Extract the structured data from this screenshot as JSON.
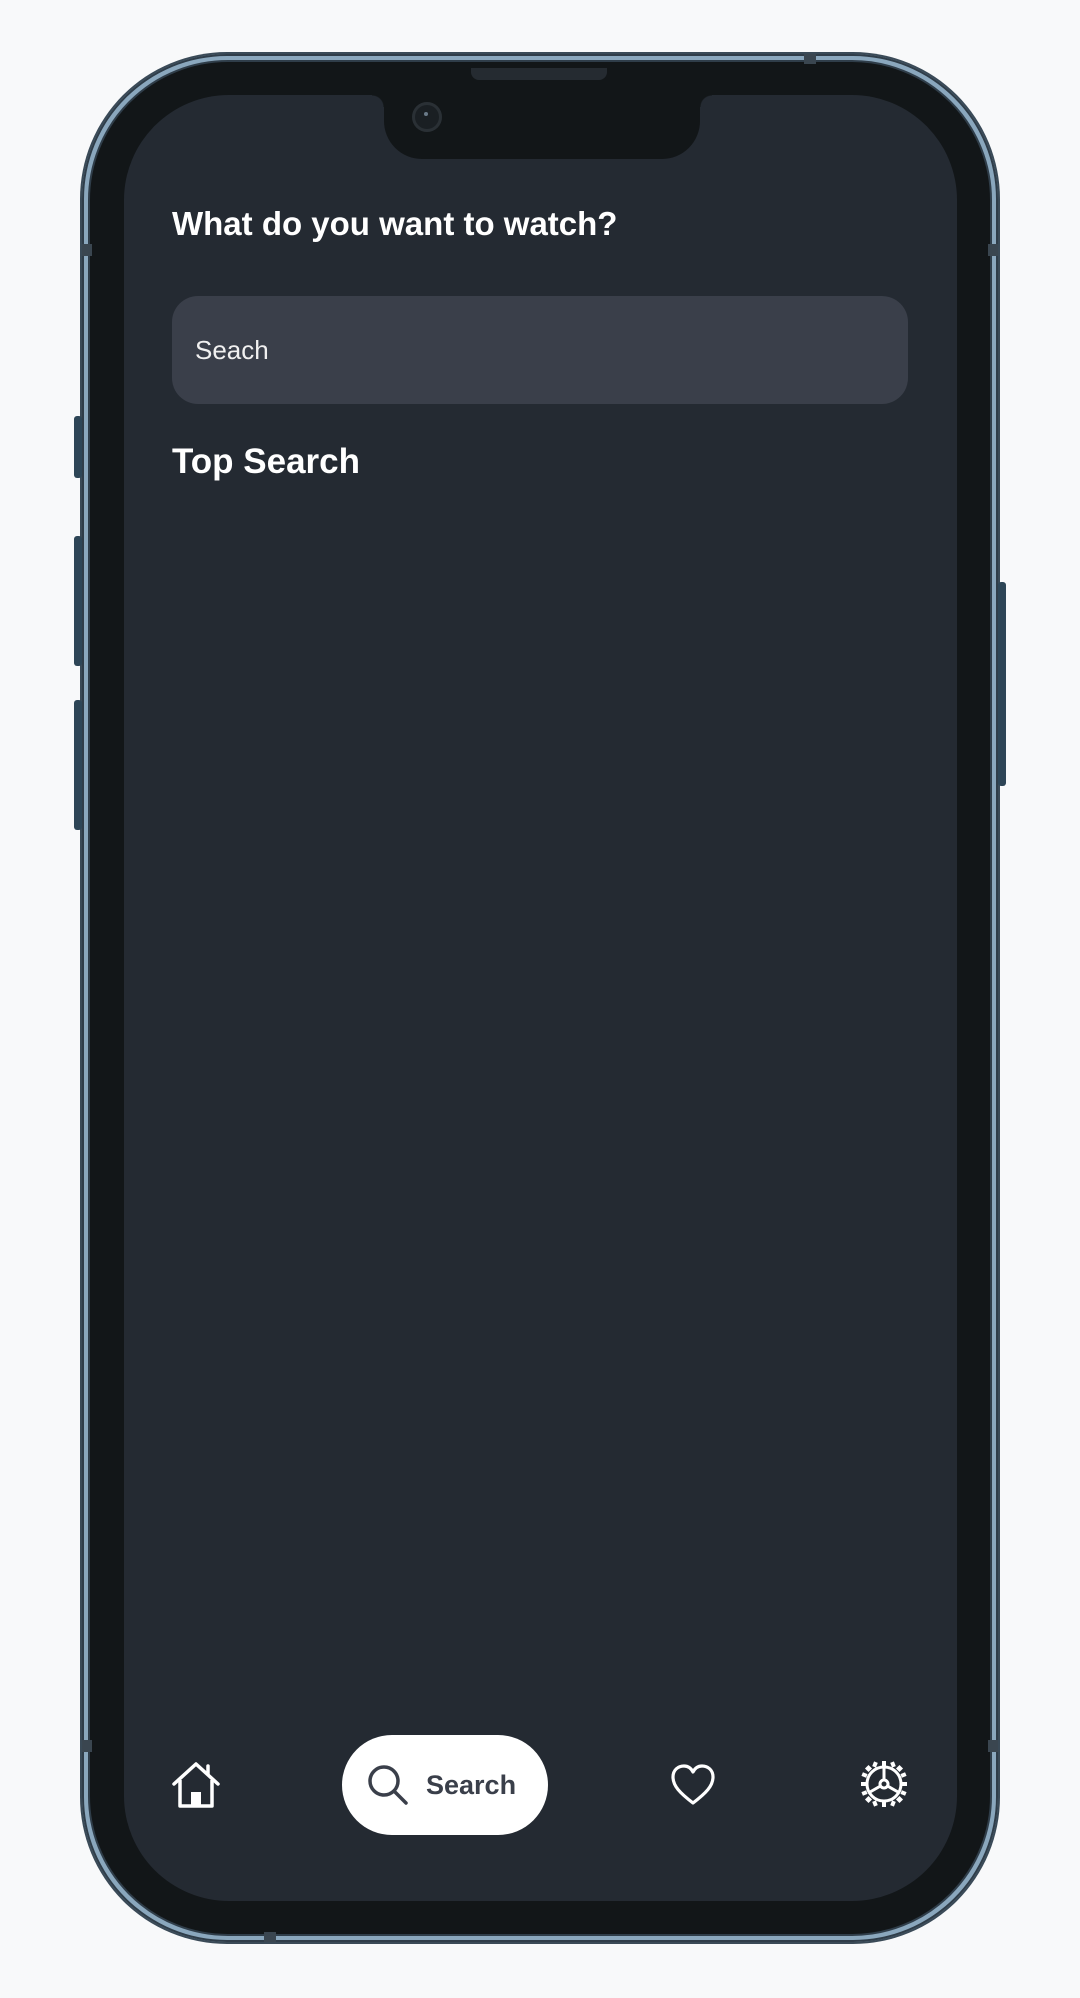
{
  "header": {
    "title": "What do you want to watch?"
  },
  "search": {
    "placeholder": "Seach",
    "value": ""
  },
  "sections": {
    "top_search_title": "Top Search"
  },
  "bottom_nav": {
    "items": [
      {
        "icon": "home-icon",
        "label": "",
        "active": false
      },
      {
        "icon": "search-icon",
        "label": "Search",
        "active": true
      },
      {
        "icon": "heart-icon",
        "label": "",
        "active": false
      },
      {
        "icon": "gear-icon",
        "label": "",
        "active": false
      }
    ]
  },
  "colors": {
    "screen_bg": "#242a32",
    "search_bg": "#3a3f4a",
    "active_tab_bg": "#ffffff",
    "active_tab_text": "#3a3f4a",
    "text": "#ffffff",
    "frame": "#8aa7bd"
  }
}
